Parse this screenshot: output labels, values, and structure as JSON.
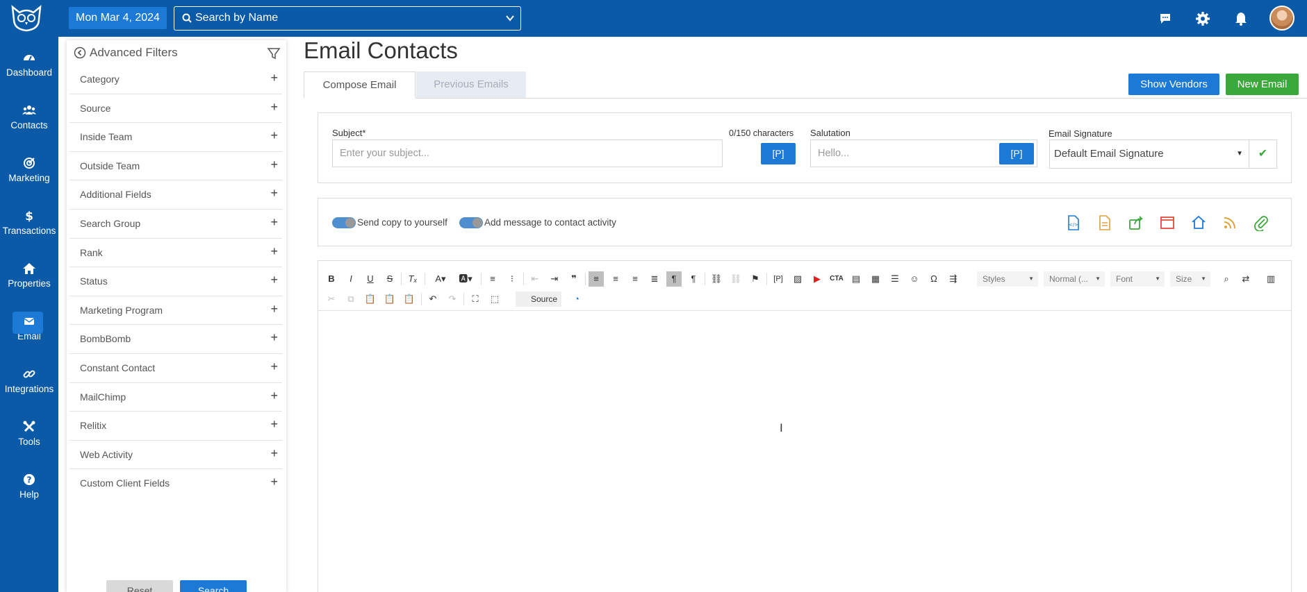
{
  "topbar": {
    "date": "Mon Mar 4, 2024",
    "search_placeholder": "Search by Name"
  },
  "nav": [
    {
      "label": "Dashboard",
      "icon": "dashboard-icon"
    },
    {
      "label": "Contacts",
      "icon": "contacts-icon"
    },
    {
      "label": "Marketing",
      "icon": "marketing-icon"
    },
    {
      "label": "Transactions",
      "icon": "dollar-icon"
    },
    {
      "label": "Properties",
      "icon": "home-icon"
    },
    {
      "label": "Email",
      "icon": "email-icon",
      "active": true
    },
    {
      "label": "Integrations",
      "icon": "link-icon"
    },
    {
      "label": "Tools",
      "icon": "tools-icon"
    },
    {
      "label": "Help",
      "icon": "help-icon"
    }
  ],
  "filters": {
    "title": "Advanced Filters",
    "items": [
      "Category",
      "Source",
      "Inside Team",
      "Outside Team",
      "Additional Fields",
      "Search Group",
      "Rank",
      "Status",
      "Marketing Program",
      "BombBomb",
      "Constant Contact",
      "MailChimp",
      "Relitix",
      "Web Activity",
      "Custom Client Fields"
    ],
    "reset_label": "Reset",
    "search_label": "Search"
  },
  "main": {
    "title": "Email Contacts",
    "tabs": [
      "Compose Email",
      "Previous Emails"
    ],
    "show_vendors_label": "Show Vendors",
    "new_email_label": "New Email",
    "subject_label": "Subject*",
    "subject_count": "0/150 characters",
    "subject_placeholder": "Enter your subject...",
    "p_label": "[P]",
    "salutation_label": "Salutation",
    "salutation_placeholder": "Hello...",
    "signature_label": "Email Signature",
    "signature_value": "Default Email Signature",
    "toggle_copy_label": "Send copy to yourself",
    "toggle_activity_label": "Add message to contact activity"
  },
  "editor": {
    "styles_label": "Styles",
    "format_label": "Normal (...",
    "font_label": "Font",
    "size_label": "Size",
    "source_label": "Source"
  },
  "colors": {
    "brand": "#0a5aa8",
    "accent": "#1c7ad6",
    "success": "#3aa83a"
  }
}
